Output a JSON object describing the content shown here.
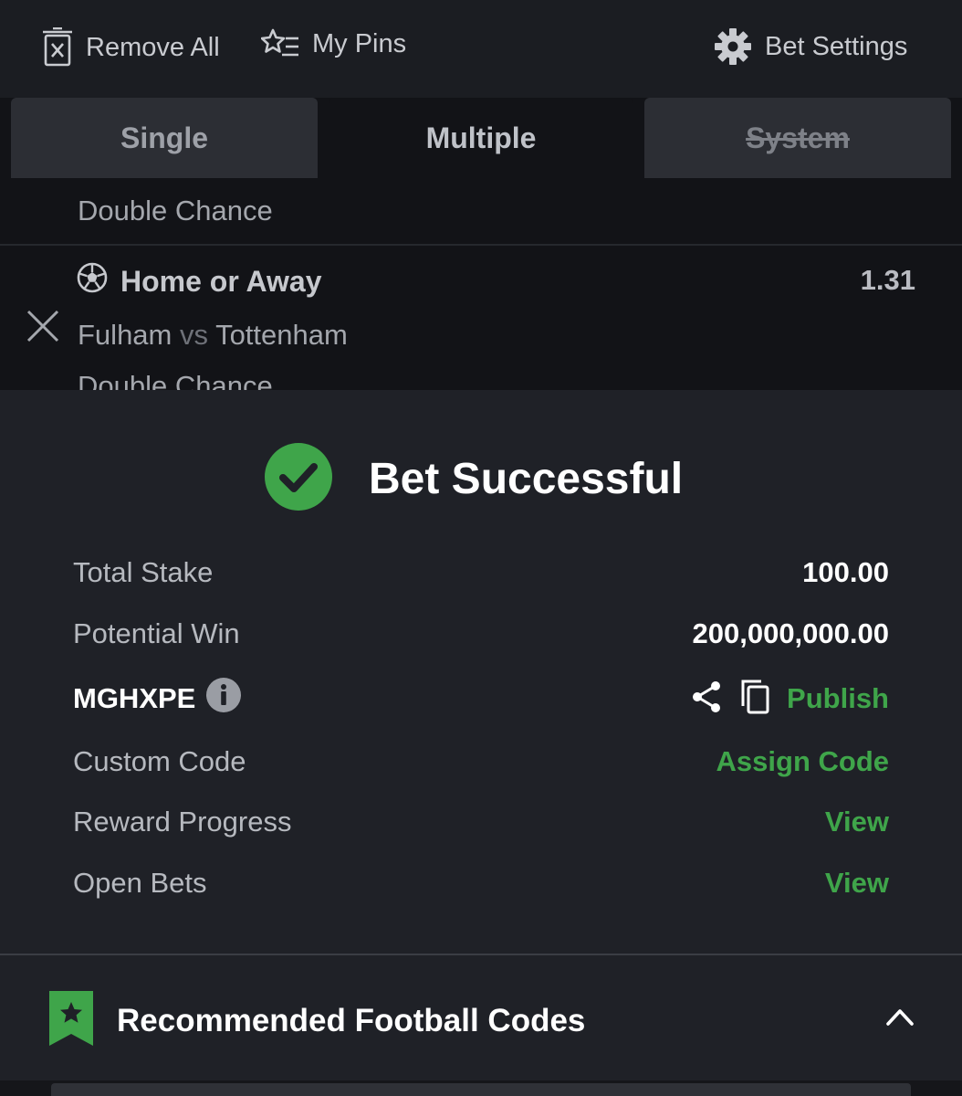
{
  "toolbar": {
    "remove_all": "Remove All",
    "my_pins": "My Pins",
    "bet_settings": "Bet Settings"
  },
  "tabs": [
    {
      "label": "Single"
    },
    {
      "label": "Multiple"
    },
    {
      "label": "System"
    }
  ],
  "betslip": {
    "prev_market": "Double Chance",
    "selection": {
      "pick": "Home or Away",
      "odds": "1.31",
      "home": "Fulham",
      "vs": "vs",
      "away": "Tottenham",
      "market": "Double Chance"
    }
  },
  "result": {
    "title": "Bet Successful",
    "total_stake_label": "Total Stake",
    "total_stake": "100.00",
    "potential_win_label": "Potential Win",
    "potential_win": "200,000,000.00",
    "booking_code": "MGHXPE",
    "publish": "Publish",
    "custom_code_label": "Custom Code",
    "assign_code": "Assign Code",
    "reward_progress_label": "Reward Progress",
    "reward_view": "View",
    "open_bets_label": "Open Bets",
    "open_bets_view": "View"
  },
  "recommended": {
    "title": "Recommended Football Codes"
  },
  "colors": {
    "accent_green": "#3fa54a",
    "background": "#1f2127"
  }
}
